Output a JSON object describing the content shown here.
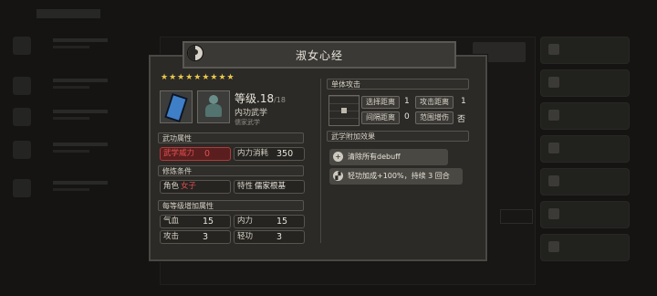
{
  "dialog": {
    "title": "淑女心经",
    "stars": "★★★★★★★★★",
    "level_label": "等级.18",
    "level_max": "/18",
    "skill_type": "内功武学",
    "skill_subtype": "儒家武学"
  },
  "attributes": {
    "header": "武功属性",
    "main_stat_label": "武学威力",
    "main_stat_value": "0",
    "cost_label": "内力消耗",
    "cost_value": "350"
  },
  "requirements": {
    "header": "修炼条件",
    "gender_label": "角色",
    "gender_value": "女子",
    "trait_label": "特性",
    "trait_value": "儒家根基"
  },
  "per_level": {
    "header": "每等级增加属性",
    "items": [
      {
        "label": "气血",
        "value": "15"
      },
      {
        "label": "内力",
        "value": "15"
      },
      {
        "label": "攻击",
        "value": "3"
      },
      {
        "label": "轻功",
        "value": "3"
      }
    ]
  },
  "attack": {
    "header": "单体攻击",
    "select_range_label": "选择距离",
    "select_range_value": "1",
    "attack_range_label": "攻击距离",
    "attack_range_value": "1",
    "interval_label": "间隔距离",
    "interval_value": "0",
    "area_label": "范围增伤",
    "area_value": "否"
  },
  "effects": {
    "header": "武学附加效果",
    "items": [
      {
        "icon": "plus-icon",
        "text": "清除所有debuff"
      },
      {
        "icon": "boot-icon",
        "text": "轻功加成+100%，持续 3 回合"
      }
    ]
  },
  "colors": {
    "accent_red": "#b03a3a",
    "star": "#e9c84a"
  }
}
